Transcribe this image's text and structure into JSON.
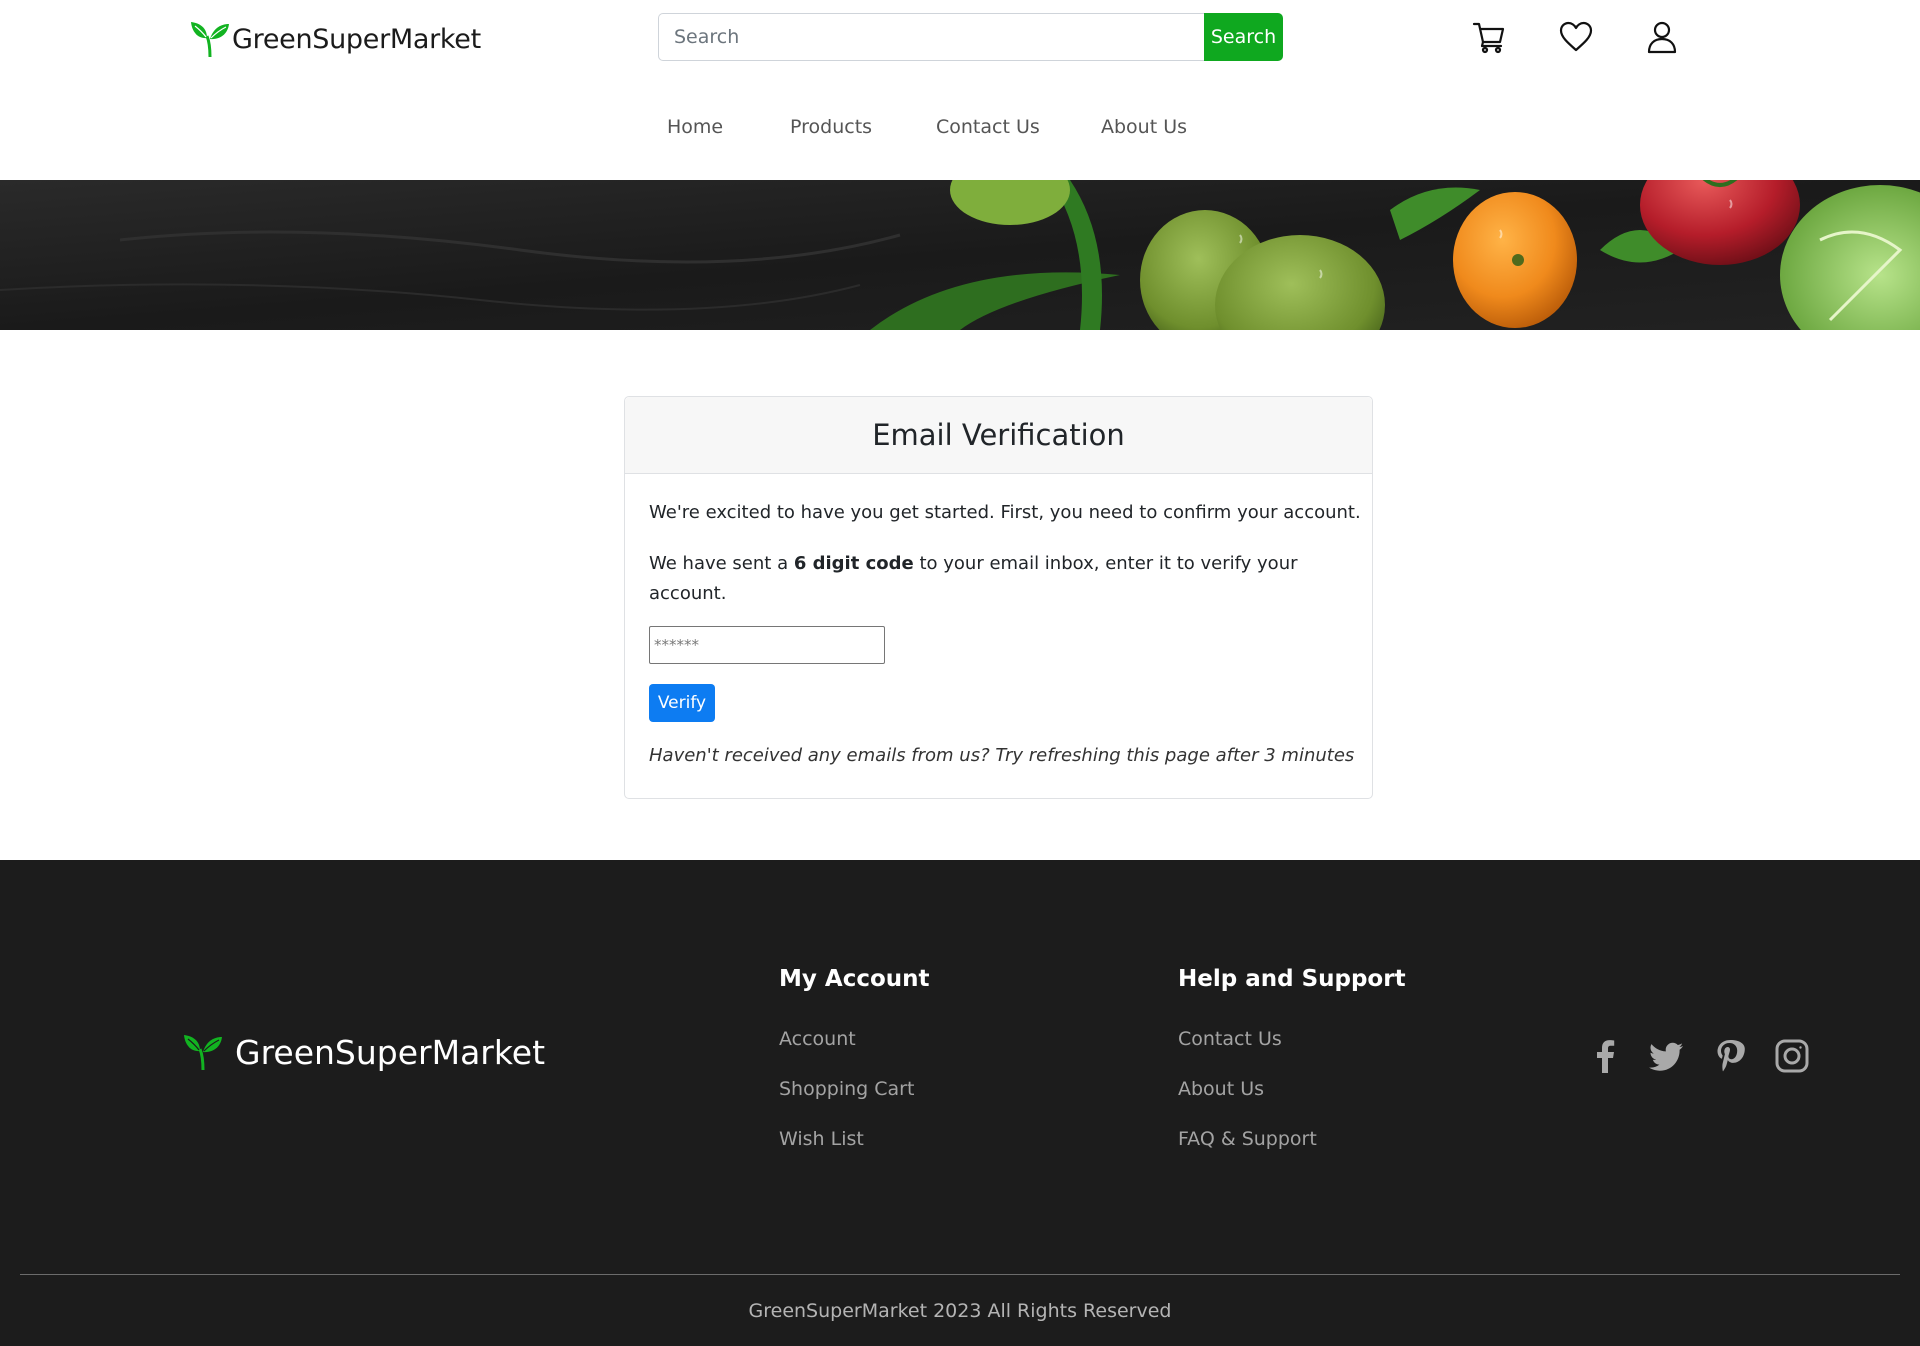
{
  "brand": {
    "name": "GreenSuperMarket",
    "accent_color": "#0fa81f",
    "leaf_color": "#12b321"
  },
  "header": {
    "search": {
      "placeholder": "Search",
      "button_label": "Search"
    },
    "icons": [
      "cart-icon",
      "heart-icon",
      "user-icon"
    ]
  },
  "nav": {
    "items": [
      {
        "label": "Home"
      },
      {
        "label": "Products"
      },
      {
        "label": "Contact Us"
      },
      {
        "label": "About Us"
      }
    ]
  },
  "banner": {
    "description_icon": "vegetables-banner-image"
  },
  "verification": {
    "title": "Email Verification",
    "intro": "We're excited to have you get started. First, you need to confirm your account.",
    "sent_prefix": "We have sent a ",
    "sent_bold": "6 digit code",
    "sent_suffix": " to your email inbox, enter it to verify your account.",
    "code_placeholder": "******",
    "verify_label": "Verify",
    "verify_color": "#0d7cf2",
    "note": "Haven't received any emails from us? Try refreshing this page after 3 minutes"
  },
  "footer": {
    "brand": "GreenSuperMarket",
    "account": {
      "title": "My Account",
      "links": [
        {
          "label": "Account"
        },
        {
          "label": "Shopping Cart"
        },
        {
          "label": "Wish List"
        }
      ]
    },
    "support": {
      "title": "Help and Support",
      "links": [
        {
          "label": "Contact Us"
        },
        {
          "label": "About Us"
        },
        {
          "label": "FAQ & Support"
        }
      ]
    },
    "social": [
      "facebook-icon",
      "twitter-icon",
      "pinterest-icon",
      "instagram-icon"
    ],
    "copyright": "GreenSuperMarket 2023 All Rights Reserved"
  }
}
